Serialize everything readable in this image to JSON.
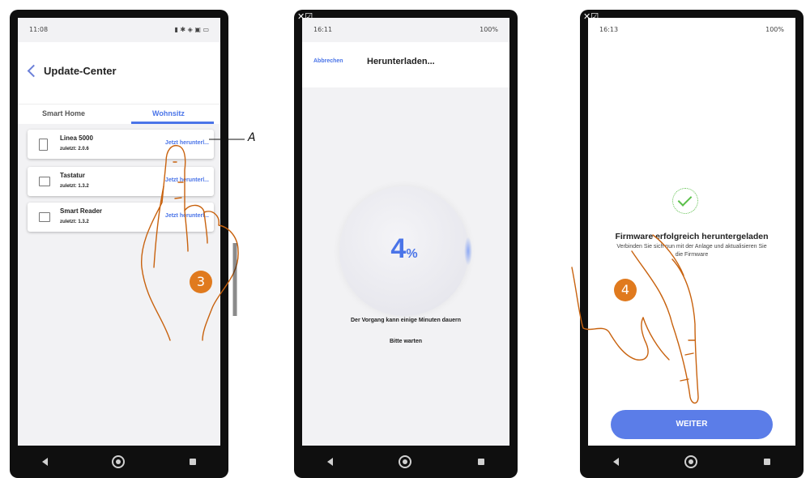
{
  "phone1": {
    "status_time": "11:08",
    "header_title": "Update-Center",
    "tabs": [
      {
        "label": "Smart Home"
      },
      {
        "label": "Wohnsitz"
      }
    ],
    "devices": [
      {
        "name": "Linea 5000",
        "version": "zuletzt: 2.0.6",
        "action": "Jetzt herunterl..."
      },
      {
        "name": "Tastatur",
        "version": "zuletzt: 1.3.2",
        "action": "Jetzt herunterl..."
      },
      {
        "name": "Smart Reader",
        "version": "zuletzt: 1.3.2",
        "action": "Jetzt herunterl..."
      }
    ],
    "callout_label": "A",
    "step": "3"
  },
  "phone2": {
    "status_time": "16:11",
    "status_battery": "100%",
    "cancel_label": "Abbrechen",
    "header_title": "Herunterladen...",
    "progress_value": "4",
    "progress_unit": "%",
    "info_line1": "Der Vorgang kann einige Minuten dauern",
    "info_line2": "Bitte warten"
  },
  "phone3": {
    "status_time": "16:13",
    "status_battery": "100%",
    "success_title": "Firmware erfolgreich heruntergeladen",
    "success_text": "Verbinden Sie sich nun mit der Anlage und aktualisieren Sie die Firmware",
    "next_label": "WEITER",
    "step": "4"
  },
  "colors": {
    "accent": "#4a74e8",
    "step_badge": "#e07a1e",
    "success": "#5bbf4a",
    "hand_outline": "#c8620e"
  }
}
